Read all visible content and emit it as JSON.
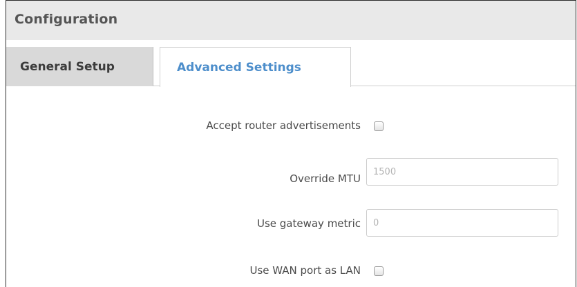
{
  "header": {
    "title": "Configuration"
  },
  "tabs": {
    "general": "General Setup",
    "advanced": "Advanced Settings",
    "active": "advanced"
  },
  "form": {
    "accept_ra": {
      "label": "Accept router advertisements",
      "checked": false
    },
    "override_mtu": {
      "label": "Override MTU",
      "placeholder": "1500",
      "value": ""
    },
    "gateway_metric": {
      "label": "Use gateway metric",
      "placeholder": "0",
      "value": ""
    },
    "wan_as_lan": {
      "label": "Use WAN port as LAN",
      "checked": false
    }
  },
  "colors": {
    "accent": "#4d8ecb",
    "header_bg": "#e9e9e9",
    "inactive_tab_bg": "#d9d9d9"
  }
}
